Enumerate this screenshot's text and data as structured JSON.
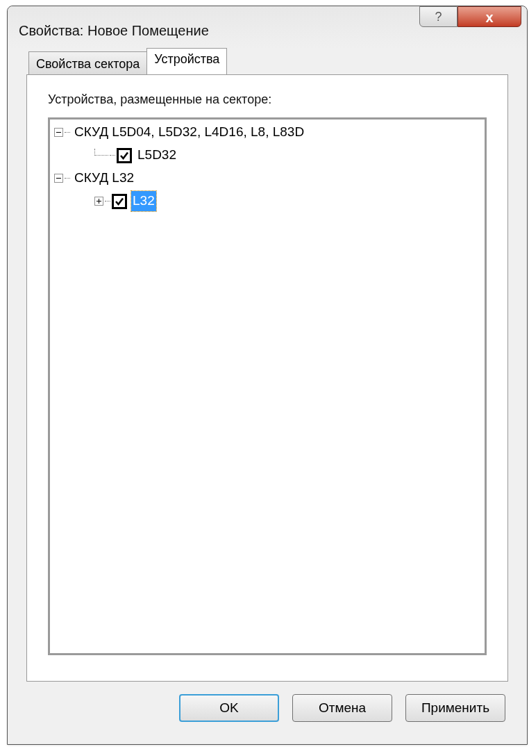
{
  "window": {
    "title": "Свойства: Новое Помещение",
    "help_button": "?",
    "close_button": "x"
  },
  "tabs": [
    {
      "label": "Свойства сектора",
      "selected": false
    },
    {
      "label": "Устройства",
      "selected": true
    }
  ],
  "tree_label": "Устройства, размещенные на секторе:",
  "tree": [
    {
      "label": "СКУД L5D04, L5D32, L4D16, L8, L83D",
      "expanded": true,
      "kind": "group",
      "children": [
        {
          "label": "L5D32",
          "kind": "device",
          "checked": true,
          "selected": false
        }
      ]
    },
    {
      "label": "СКУД L32",
      "expanded": true,
      "kind": "group",
      "children": [
        {
          "label": "L32",
          "kind": "device",
          "checked": true,
          "selected": true,
          "expanded": false
        }
      ]
    }
  ],
  "buttons": [
    {
      "label": "OK",
      "default": true
    },
    {
      "label": "Отмена",
      "default": false
    },
    {
      "label": "Применить",
      "default": false
    }
  ]
}
